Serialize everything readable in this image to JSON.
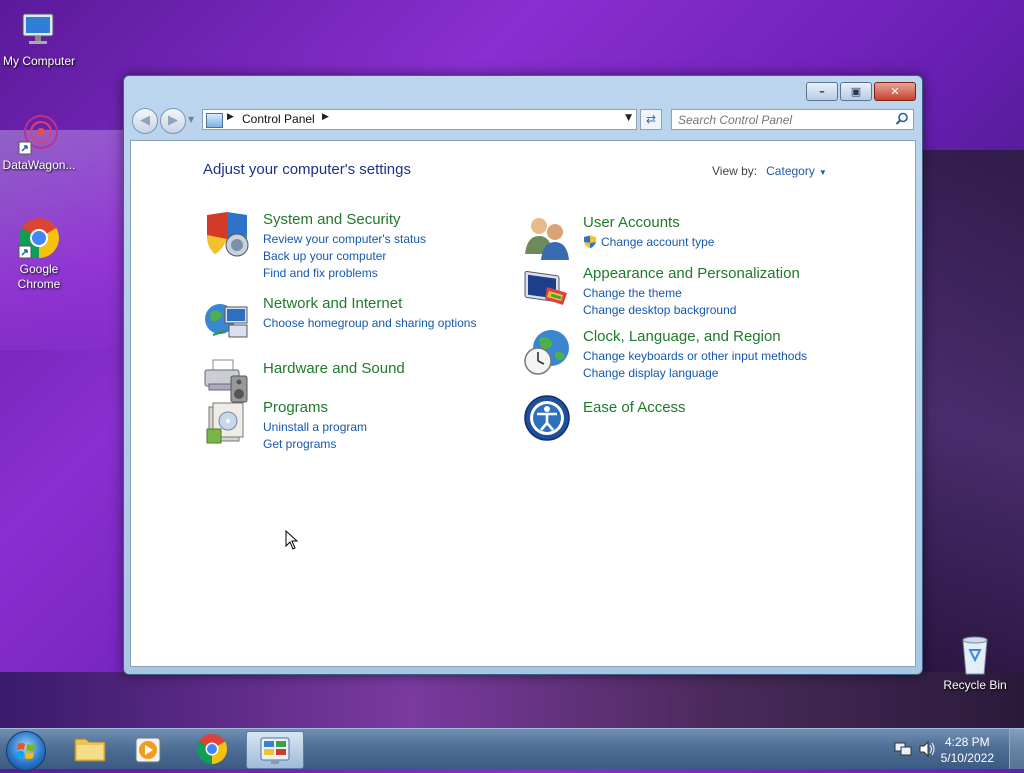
{
  "desktop": {
    "icons": [
      {
        "label": "My Computer"
      },
      {
        "label": "DataWagon..."
      },
      {
        "label": "Google Chrome"
      },
      {
        "label": "Recycle Bin"
      }
    ]
  },
  "window": {
    "address": {
      "crumb": "Control Panel"
    },
    "search": {
      "placeholder": "Search Control Panel"
    },
    "heading": "Adjust your computer's settings",
    "view_by": {
      "label": "View by:",
      "value": "Category"
    },
    "categories": [
      {
        "title": "System and Security",
        "icon": "shield-icon",
        "links": [
          "Review your computer's status",
          "Back up your computer",
          "Find and fix problems"
        ]
      },
      {
        "title": "Network and Internet",
        "icon": "network-globe-icon",
        "links": [
          "Choose homegroup and sharing options"
        ]
      },
      {
        "title": "Hardware and Sound",
        "icon": "printer-speaker-icon",
        "links": []
      },
      {
        "title": "Programs",
        "icon": "programs-box-icon",
        "links": [
          "Uninstall a program",
          "Get programs"
        ]
      },
      {
        "title": "User Accounts",
        "icon": "users-icon",
        "links": [
          "Change account type"
        ]
      },
      {
        "title": "Appearance and Personalization",
        "icon": "monitor-palette-icon",
        "links": [
          "Change the theme",
          "Change desktop background"
        ]
      },
      {
        "title": "Clock, Language, and Region",
        "icon": "clock-globe-icon",
        "links": [
          "Change keyboards or other input methods",
          "Change display language"
        ]
      },
      {
        "title": "Ease of Access",
        "icon": "ease-of-access-icon",
        "links": []
      }
    ]
  },
  "taskbar": {
    "clock": {
      "time": "4:28 PM",
      "date": "5/10/2022"
    }
  }
}
